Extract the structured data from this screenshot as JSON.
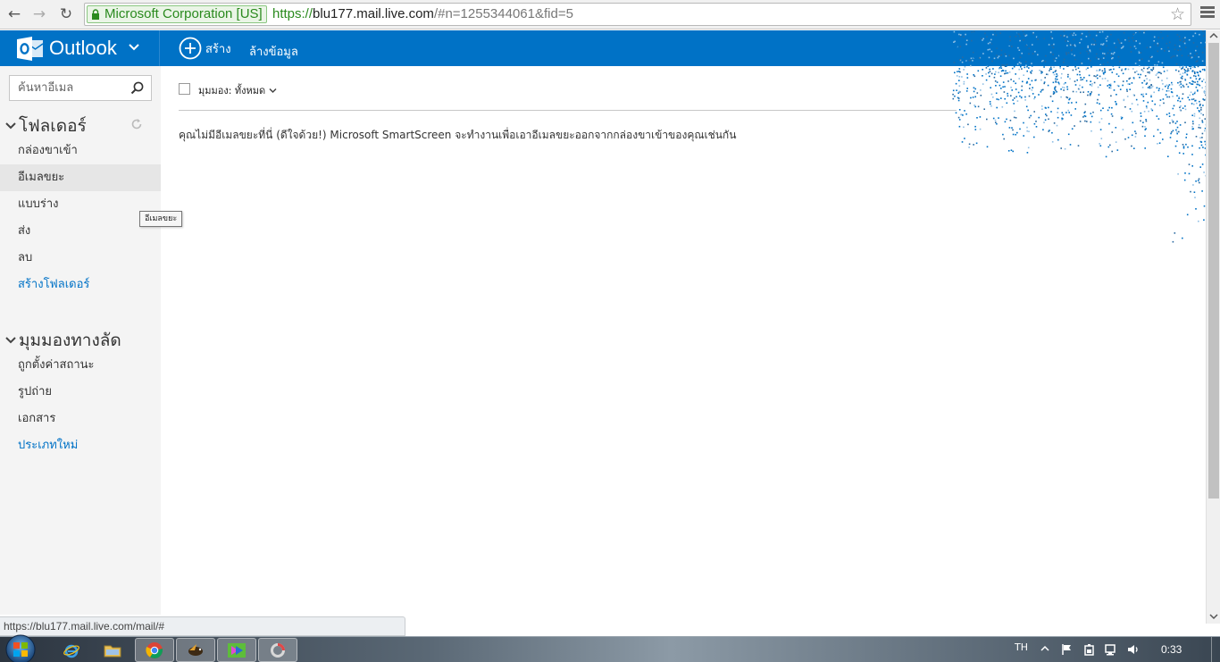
{
  "browser": {
    "ev_label": "Microsoft Corporation [US]",
    "url_scheme": "https://",
    "url_host": "blu177.mail.live.com",
    "url_path": "/#n=1255344061&fid=5"
  },
  "header": {
    "brand": "Outlook",
    "new_label": "สร้าง",
    "clear_label": "ล้างข้อมูล"
  },
  "sidebar": {
    "search_placeholder": "ค้นหาอีเมล",
    "folders_title": "โฟลเดอร์",
    "folders": [
      {
        "label": "กล่องขาเข้า"
      },
      {
        "label": "อีเมลขยะ"
      },
      {
        "label": "แบบร่าง"
      },
      {
        "label": "ส่ง"
      },
      {
        "label": "ลบ"
      }
    ],
    "new_folder_label": "สร้างโฟลเดอร์",
    "shortcuts_title": "มุมมองทางลัด",
    "shortcuts": [
      {
        "label": "ถูกตั้งค่าสถานะ"
      },
      {
        "label": "รูปถ่าย"
      },
      {
        "label": "เอกสาร"
      }
    ],
    "new_category_label": "ประเภทใหม่",
    "tooltip": "อีเมลขยะ"
  },
  "main": {
    "view_label": "มุมมอง: ทั้งหมด",
    "empty_message": "คุณไม่มีอีเมลขยะที่นี่ (ดีใจด้วย!) Microsoft SmartScreen จะทำงานเพื่อเอาอีเมลขยะออกจากกล่องขาเข้าของคุณเช่นกัน"
  },
  "status_url": "https://blu177.mail.live.com/mail/#",
  "taskbar": {
    "language": "TH",
    "clock": "0:33"
  },
  "colors": {
    "brand_blue": "#0072c6",
    "ev_green": "#2a8a1e",
    "link_blue": "#0072c6"
  },
  "icons": [
    "back-arrow-icon",
    "forward-arrow-icon",
    "reload-icon",
    "lock-icon",
    "star-icon",
    "menu-icon",
    "outlook-logo-icon",
    "chevron-down-icon",
    "plus-circle-icon",
    "search-icon",
    "refresh-icon",
    "windows-start-icon",
    "internet-explorer-icon",
    "folder-icon",
    "chrome-icon",
    "bird-icon",
    "media-icon",
    "recycle-icon",
    "flag-icon",
    "battery-icon",
    "network-icon",
    "volume-icon"
  ]
}
